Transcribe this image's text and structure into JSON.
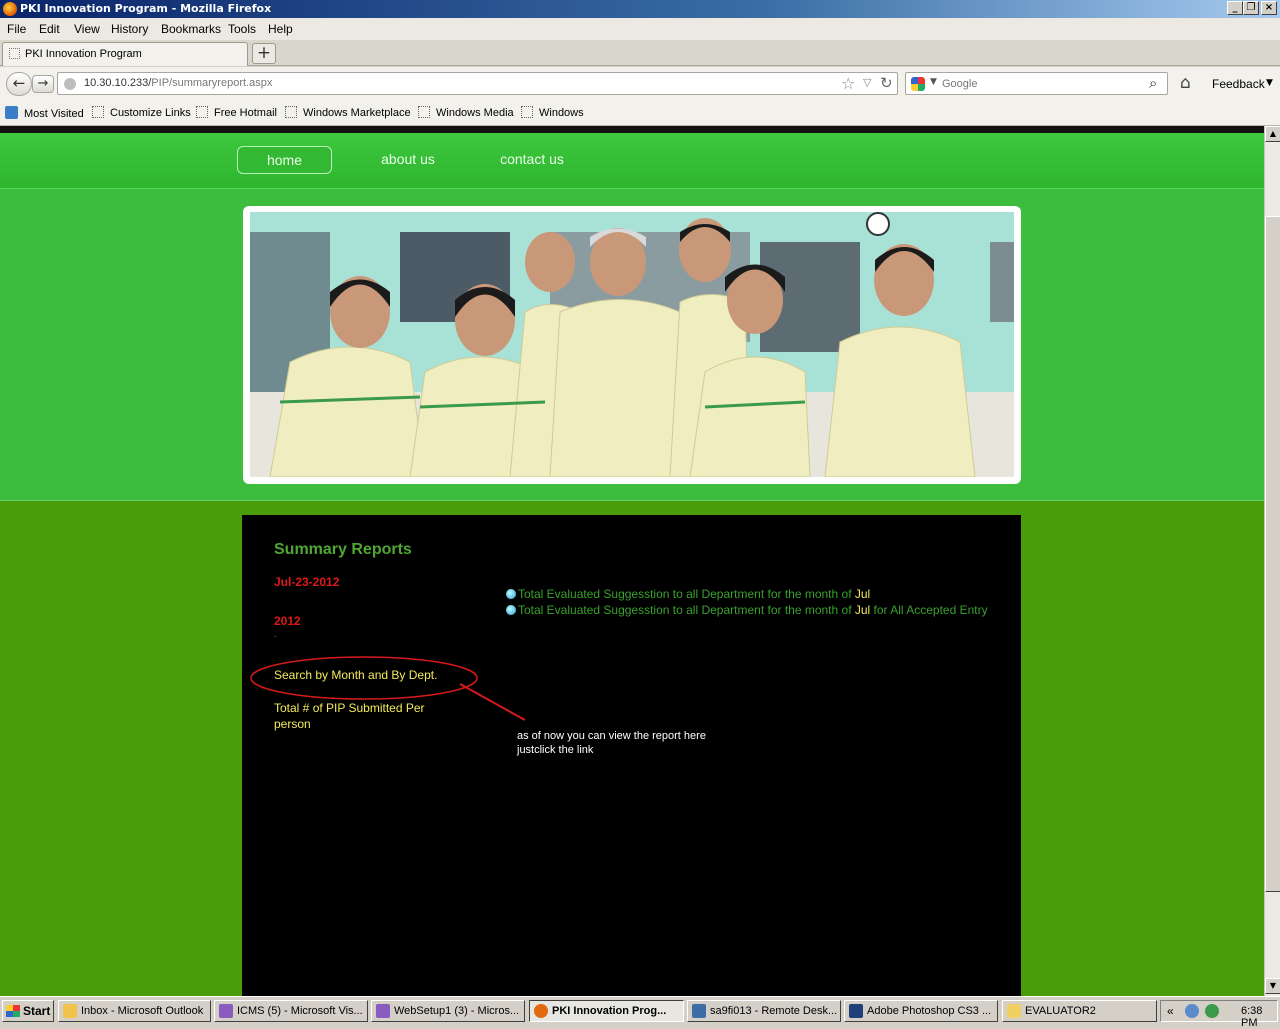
{
  "window": {
    "title": "PKI Innovation Program - Mozilla Firefox"
  },
  "menu": [
    "File",
    "Edit",
    "View",
    "History",
    "Bookmarks",
    "Tools",
    "Help"
  ],
  "tab": {
    "label": "PKI Innovation Program",
    "new_tab": "+"
  },
  "nav": {
    "back": "←",
    "forward": "→",
    "url_host": "10.30.10.233/",
    "url_path": "PIP/summaryreport.aspx",
    "search_placeholder": "Google",
    "feedback": "Feedback"
  },
  "bookmarks": [
    "Most Visited",
    "Customize Links",
    "Free Hotmail",
    "Windows Marketplace",
    "Windows Media",
    "Windows"
  ],
  "site": {
    "nav": [
      "home",
      "about us",
      "contact us"
    ],
    "section_title": "Summary Reports",
    "date": "Jul-23-2012",
    "year": "2012",
    "dot": ".",
    "search_link": "Search by Month and By Dept.",
    "total_link": "Total # of PIP Submitted Per person",
    "link1": {
      "before": "Total Evaluated Suggesstion to all Department for  the month of ",
      "month": "Jul",
      "after": ""
    },
    "link2": {
      "before": "Total Evaluated Suggesstion to all Department for  the month of ",
      "month": "Jul",
      "after": " for All Accepted Entry"
    },
    "annotation": [
      "as of now you can view the report here",
      "justclick the link"
    ]
  },
  "taskbar": {
    "start": "Start",
    "tasks": [
      "Inbox - Microsoft Outlook",
      "ICMS (5) - Microsoft Vis...",
      "WebSetup1 (3) - Micros...",
      "PKI Innovation Prog...",
      "sa9fi013 - Remote Desk...",
      "Adobe Photoshop CS3 ...",
      "EVALUATOR2"
    ],
    "tray_chevron": "«",
    "clock": "6:38 PM"
  }
}
